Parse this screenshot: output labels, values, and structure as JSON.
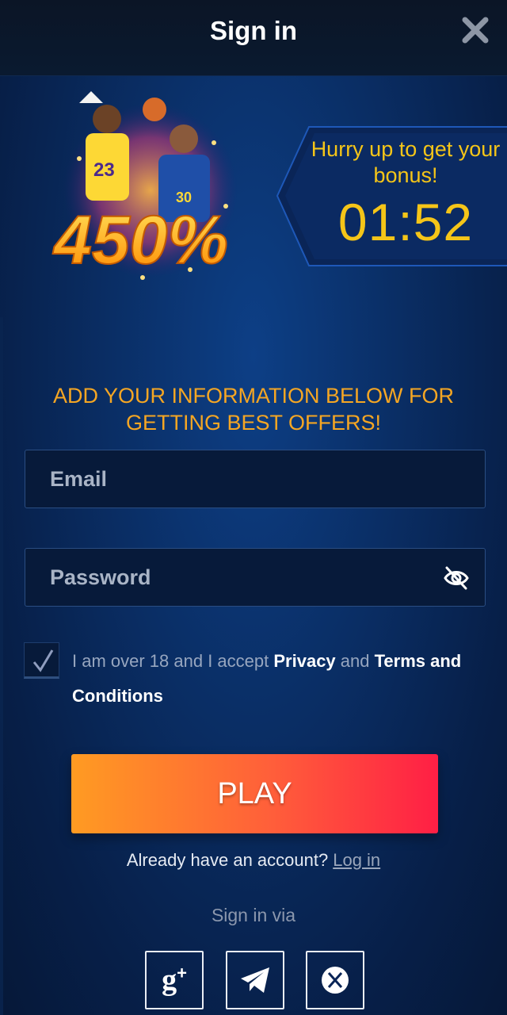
{
  "header": {
    "title": "Sign in"
  },
  "promo": {
    "percent": "450%",
    "bonus_text": "Hurry up to get your bonus!",
    "timer": "01:52"
  },
  "info": {
    "text": "ADD YOUR INFORMATION BELOW FOR GETTING BEST OFFERS!"
  },
  "form": {
    "email_placeholder": "Email",
    "password_placeholder": "Password",
    "terms_prefix": "I am over 18 and I accept ",
    "privacy_link": "Privacy",
    "terms_and": " and ",
    "terms_link": "Terms and Conditions",
    "checkbox_checked": true,
    "play_label": "PLAY"
  },
  "account": {
    "question": "Already have an account?",
    "login_link": "Log in"
  },
  "social": {
    "label": "Sign in via",
    "buttons": [
      {
        "icon": "google-plus-icon",
        "text": "g+"
      },
      {
        "icon": "telegram-icon"
      },
      {
        "icon": "x-icon"
      }
    ]
  },
  "colors": {
    "accent_yellow": "#f5c518",
    "accent_orange": "#f5a623",
    "play_gradient_start": "#ff9b22",
    "play_gradient_end": "#ff1f45",
    "background": "#0a2e65"
  }
}
